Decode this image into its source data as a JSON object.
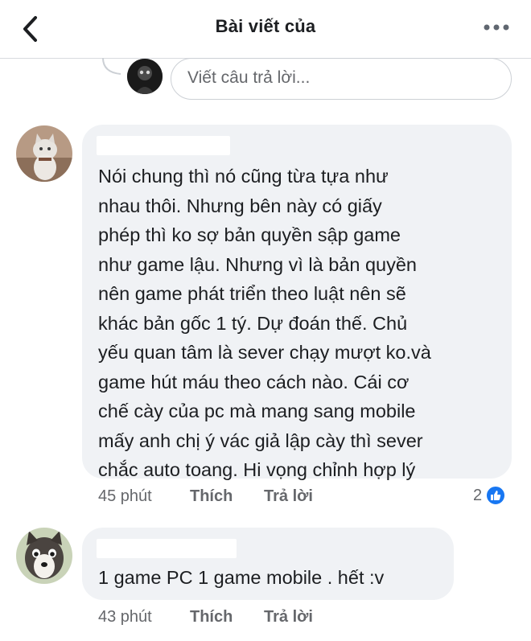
{
  "header": {
    "title": "Bài viết của",
    "back_icon": "chevron-left-icon",
    "more_icon": "more-horizontal-icon"
  },
  "reply_box": {
    "placeholder": "Viết câu trả lời..."
  },
  "comments": [
    {
      "text": "Nói chung thì nó cũng từa tựa như\nnhau thôi. Nhưng bên này có giấy\nphép thì ko sợ bản quyền sập game\nnhư game lậu. Nhưng vì là bản quyền\nnên game phát triển theo luật nên sẽ\nkhác bản gốc 1 tý. Dự đoán thế. Chủ\nyếu quan tâm là sever chạy mượt ko.và\ngame hút máu theo cách nào. Cái cơ\nchế cày của pc mà mang sang mobile\nmấy anh chị ý vác giả lập cày thì sever\nchắc auto toang. Hi vọng chỉnh hợp lý",
      "time": "45 phút",
      "like_label": "Thích",
      "reply_label": "Trả lời",
      "reaction_count": "2",
      "reaction_icon": "thumbs-up-icon"
    },
    {
      "text": "1 game PC 1 game mobile . hết :v",
      "time": "43 phút",
      "like_label": "Thích",
      "reply_label": "Trả lời"
    }
  ],
  "colors": {
    "bubble": "#f0f2f5",
    "secondary_text": "#65676b",
    "like_blue": "#1877f2"
  }
}
